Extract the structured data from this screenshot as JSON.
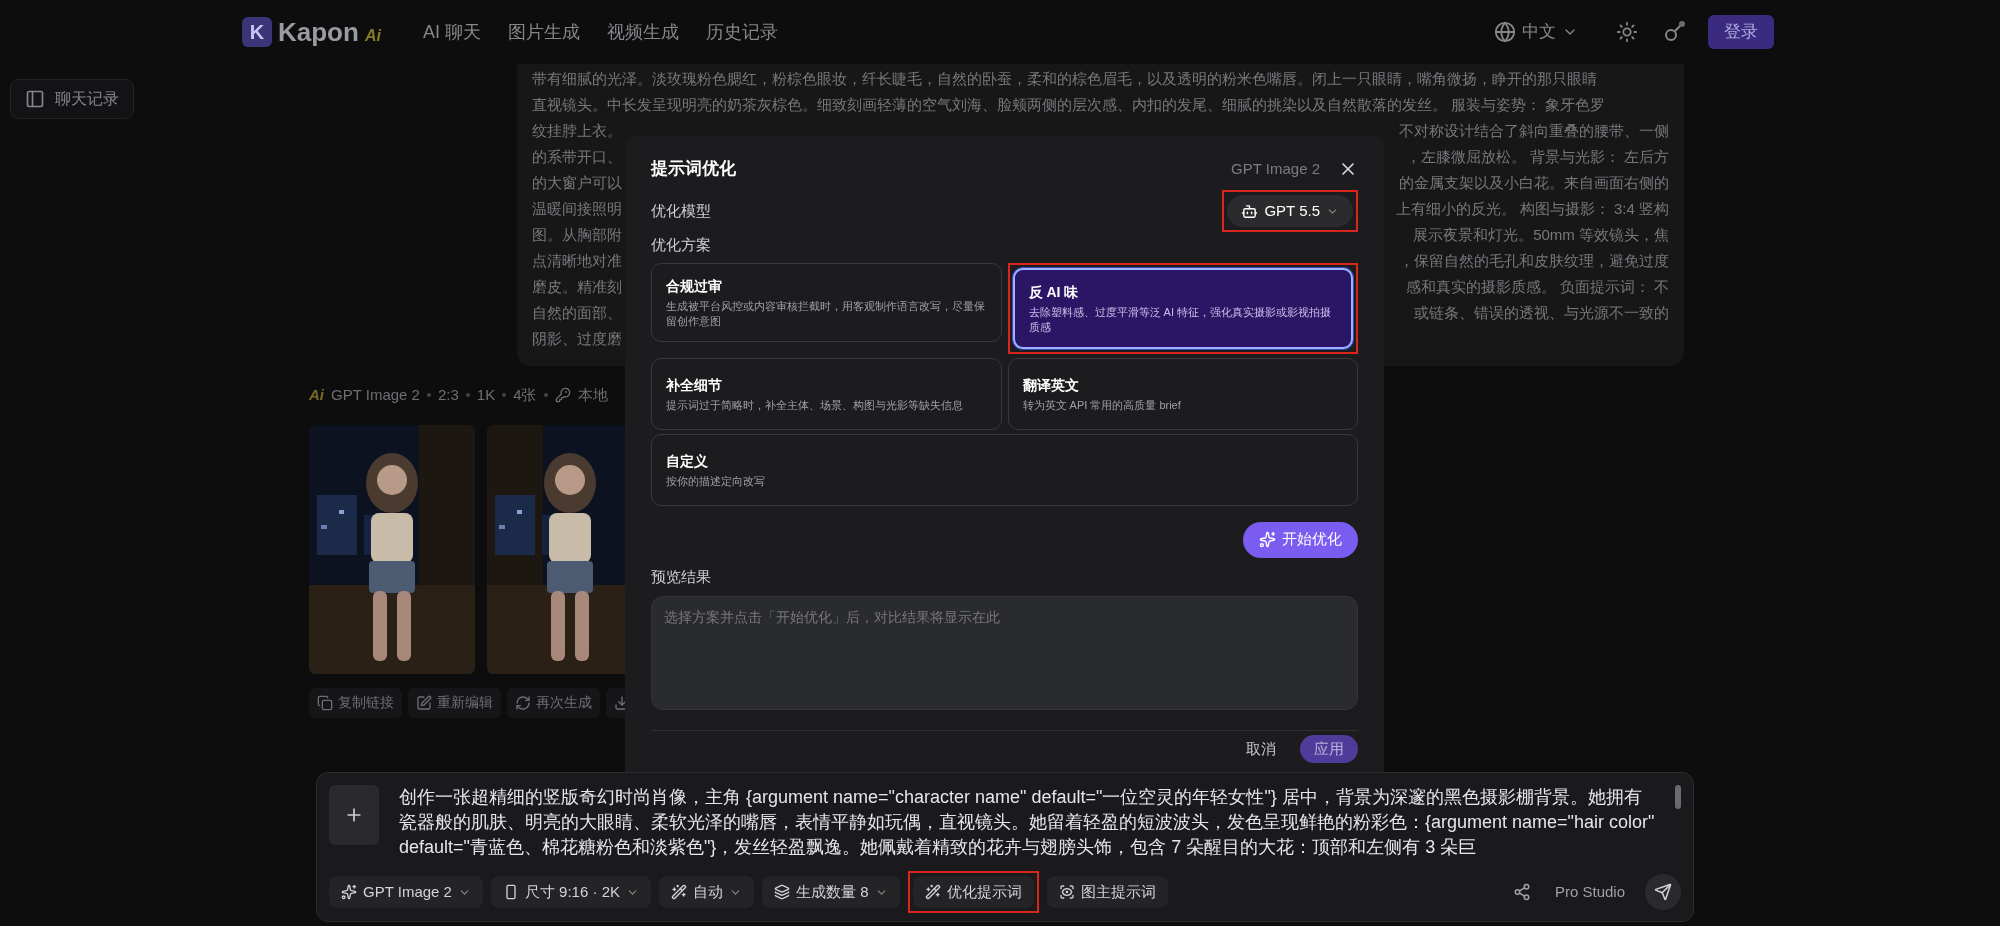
{
  "nav": {
    "logo_mark": "K",
    "logo_text": "Kapon",
    "logo_badge": "Ai",
    "links": [
      {
        "label": "AI 聊天"
      },
      {
        "label": "图片生成"
      },
      {
        "label": "视频生成"
      },
      {
        "label": "历史记录"
      }
    ],
    "language": "中文",
    "login": "登录"
  },
  "sidebar_toggle": {
    "label": "聊天记录"
  },
  "prompt_card": {
    "lines": [
      {
        "text": "带有细腻的光泽。淡玫瑰粉色腮红，粉棕色眼妆，纤长睫毛，自然的卧蚕，柔和的棕色眉毛，以及透明的粉米色嘴唇。闭上一只眼睛，嘴角微扬，睁开的那只眼睛"
      },
      {
        "text": "直视镜头。中长发呈现明亮的奶茶灰棕色。细致刻画轻薄的空气刘海、脸颊两侧的层次感、内扣的发尾、细腻的挑染以及自然散落的发丝。 服装与姿势： 象牙色罗"
      },
      {
        "left": "纹挂脖上衣。",
        "right": "不对称设计结合了斜向重叠的腰带、一侧"
      },
      {
        "left": "的系带开口、",
        "right": "，左膝微屈放松。 背景与光影： 左后方"
      },
      {
        "left": "的大窗户可以",
        "right": "的金属支架以及小白花。来自画面右侧的"
      },
      {
        "left": "温暖间接照明",
        "right": "上有细小的反光。 构图与摄影： 3:4 竖构"
      },
      {
        "left": "图。从胸部附",
        "right": "展示夜景和灯光。50mm 等效镜头，焦"
      },
      {
        "left": "点清晰地对准",
        "right": "，保留自然的毛孔和皮肤纹理，避免过度"
      },
      {
        "left": "磨皮。精准刻",
        "right": "感和真实的摄影质感。 负面提示词： 不"
      },
      {
        "left": "自然的面部、",
        "right": "或链条、错误的透视、与光源不一致的"
      },
      {
        "left": "阴影、过度磨"
      }
    ]
  },
  "result": {
    "badge": "Ai",
    "model": "GPT Image 2",
    "meta": [
      "2:3",
      "1K",
      "4张"
    ],
    "source": "本地",
    "images": [
      {
        "kind": "picture"
      },
      {
        "kind": "picture"
      }
    ],
    "actions": [
      {
        "kind": "copy",
        "label": "复制链接"
      },
      {
        "kind": "edit",
        "label": "重新编辑"
      },
      {
        "kind": "regenerate",
        "label": "再次生成"
      },
      {
        "kind": "download"
      }
    ]
  },
  "modal": {
    "title": "提示词优化",
    "subtitle": "GPT Image 2",
    "model_label": "优化模型",
    "model": {
      "value": "GPT 5.5",
      "highlighted": true
    },
    "plan_label": "优化方案",
    "options": [
      {
        "title": "合规过审",
        "description": "生成被平台风控或内容审核拦截时，用客观制作语言改写，尽量保留创作意图",
        "selected": false,
        "highlighted": false
      },
      {
        "title": "反 AI 味",
        "description": "去除塑料感、过度平滑等泛 AI 特征，强化真实摄影或影视拍摄质感",
        "selected": true,
        "highlighted": true
      },
      {
        "title": "补全细节",
        "description": "提示词过于简略时，补全主体、场景、构图与光影等缺失信息",
        "selected": false,
        "highlighted": false
      },
      {
        "title": "翻译英文",
        "description": "转为英文 API 常用的高质量 brief",
        "selected": false,
        "highlighted": false
      },
      {
        "title": "自定义",
        "description": "按你的描述定向改写",
        "selected": false,
        "highlighted": false
      }
    ],
    "start_button": "开始优化",
    "preview_label": "预览结果",
    "preview_placeholder": "选择方案并点击「开始优化」后，对比结果将显示在此",
    "cancel": "取消",
    "apply": "应用"
  },
  "composer": {
    "prompt": "创作一张超精细的竖版奇幻时尚肖像，主角 {argument name=\"character name\" default=\"一位空灵的年轻女性\"} 居中，背景为深邃的黑色摄影棚背景。她拥有瓷器般的肌肤、明亮的大眼睛、柔软光泽的嘴唇，表情平静如玩偶，直视镜头。她留着轻盈的短波波头，发色呈现鲜艳的粉彩色：{argument name=\"hair color\" default=\"青蓝色、棉花糖粉色和淡紫色\"}，发丝轻盈飘逸。她佩戴着精致的花卉与翅膀头饰，包含 7 朵醒目的大花：顶部和左侧有 3 朵巨",
    "tools": [
      {
        "kind": "model",
        "label": "GPT Image 2",
        "dropdown": true,
        "highlighted": false
      },
      {
        "kind": "size",
        "label": "尺寸 9:16 · 2K",
        "dropdown": true,
        "highlighted": false
      },
      {
        "kind": "auto",
        "label": "自动",
        "dropdown": true,
        "highlighted": false
      },
      {
        "kind": "count",
        "label": "生成数量 8",
        "dropdown": true,
        "highlighted": false
      },
      {
        "kind": "optimize",
        "label": "优化提示词",
        "dropdown": false,
        "highlighted": true
      },
      {
        "kind": "reverse",
        "label": "图主提示词",
        "dropdown": false,
        "highlighted": false
      }
    ],
    "studio": "Pro Studio"
  }
}
